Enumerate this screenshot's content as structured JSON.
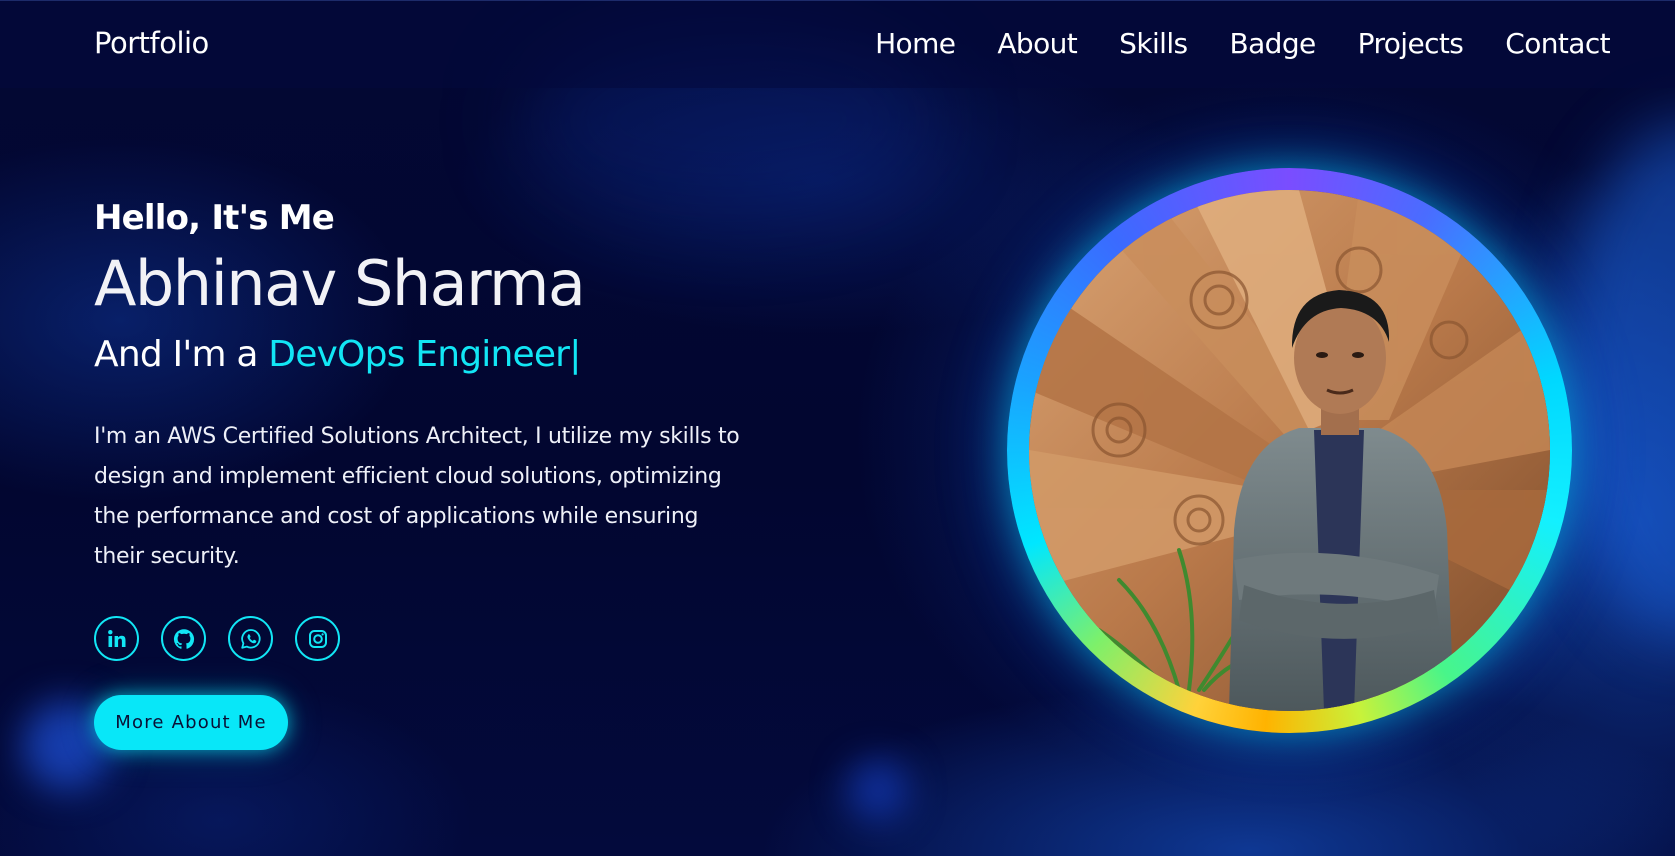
{
  "header": {
    "logo": "Portfolio",
    "nav": [
      {
        "label": "Home"
      },
      {
        "label": "About"
      },
      {
        "label": "Skills"
      },
      {
        "label": "Badge"
      },
      {
        "label": "Projects"
      },
      {
        "label": "Contact"
      }
    ]
  },
  "hero": {
    "greeting": "Hello, It's Me",
    "name": "Abhinav Sharma",
    "role_prefix": "And I'm a ",
    "role_highlight": "DevOps Engineer",
    "cursor": "|",
    "bio": "I'm an AWS Certified Solutions Architect, I utilize my skills to design and implement efficient cloud solutions, optimizing the performance and cost of applications while ensuring their security.",
    "cta_label": "More About Me",
    "socials": [
      {
        "icon": "linkedin-icon"
      },
      {
        "icon": "github-icon"
      },
      {
        "icon": "whatsapp-icon"
      },
      {
        "icon": "instagram-icon"
      }
    ],
    "profile_photo": "profile-photo"
  },
  "colors": {
    "accent": "#12e6f5",
    "background": "#02052e",
    "text": "#ffffff",
    "button_text": "#0a1036"
  }
}
